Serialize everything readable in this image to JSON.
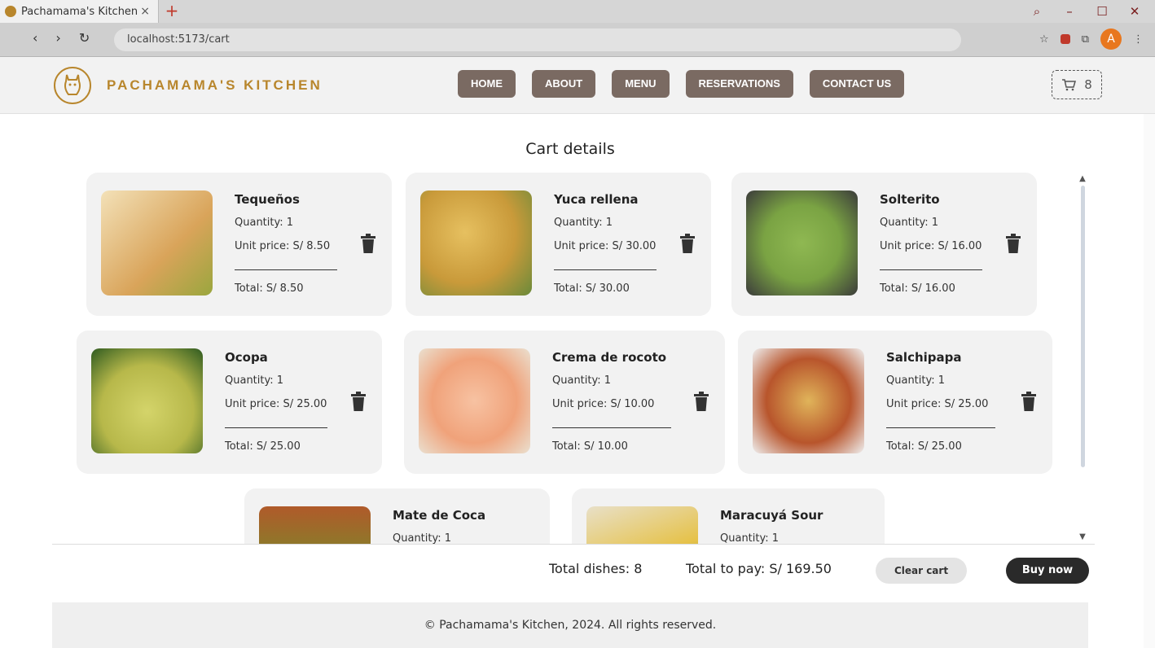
{
  "browser": {
    "tab_title": "Pachamama's Kitchen",
    "url": "localhost:5173/cart",
    "avatar_letter": "A"
  },
  "header": {
    "brand": "PACHAMAMA'S KITCHEN",
    "menu": [
      "HOME",
      "ABOUT",
      "MENU",
      "RESERVATIONS",
      "CONTACT US"
    ],
    "cart_count": "8"
  },
  "page_title": "Cart details",
  "items": [
    {
      "name": "Tequeños",
      "qty": "Quantity: 1",
      "unit": "Unit price: S/ 8.50",
      "total": "Total: S/ 8.50",
      "color": "#d9a45a"
    },
    {
      "name": "Yuca rellena",
      "qty": "Quantity: 1",
      "unit": "Unit price: S/ 30.00",
      "total": "Total: S/ 30.00",
      "color": "#c99a3a"
    },
    {
      "name": "Solterito",
      "qty": "Quantity: 1",
      "unit": "Unit price: S/ 16.00",
      "total": "Total: S/ 16.00",
      "color": "#7aa343"
    },
    {
      "name": "Ocopa",
      "qty": "Quantity: 1",
      "unit": "Unit price: S/ 25.00",
      "total": "Total: S/ 25.00",
      "color": "#b7b84a"
    },
    {
      "name": "Crema de rocoto",
      "qty": "Quantity: 1",
      "unit": "Unit price: S/ 10.00",
      "total": "Total: S/ 10.00",
      "color": "#f0a27a"
    },
    {
      "name": "Salchipapa",
      "qty": "Quantity: 1",
      "unit": "Unit price: S/ 25.00",
      "total": "Total: S/ 25.00",
      "color": "#b8552c"
    },
    {
      "name": "Mate de Coca",
      "qty": "Quantity: 1",
      "unit": "",
      "total": "",
      "color": "#8c7a2a"
    },
    {
      "name": "Maracuyá Sour",
      "qty": "Quantity: 1",
      "unit": "",
      "total": "",
      "color": "#e6c24a"
    }
  ],
  "summary": {
    "total_dishes": "Total dishes: 8",
    "total_pay": "Total to pay: S/ 169.50",
    "clear": "Clear cart",
    "buy": "Buy now"
  },
  "footer": "© Pachamama's Kitchen, 2024. All rights reserved."
}
